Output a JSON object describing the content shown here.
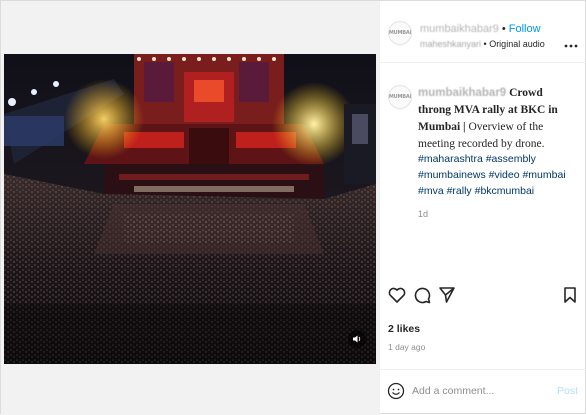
{
  "post": {
    "username": "mumbaikhabar9",
    "follow_label": "Follow",
    "audio_user": "maheshkanyari",
    "audio_label": "Original audio",
    "avatar_text": "MUMBAI",
    "caption_user": "mumbaikhabar9",
    "caption_title": "Crowd throng MVA rally at BKC in Mumbai |",
    "caption_body": "Overview of the meeting recorded by drone.",
    "hashtags": "#maharashtra #assembly #mumbainews #video #mumbai #mva #rally #bkcmumbai",
    "caption_age": "1d",
    "likes": "2 likes",
    "posted_ago": "1 day ago",
    "comment_placeholder": "Add a comment...",
    "post_label": "Post"
  },
  "icons": {
    "more": "more-options-icon",
    "like": "heart-icon",
    "comment": "comment-icon",
    "share": "send-icon",
    "save": "bookmark-icon",
    "emoji": "emoji-icon",
    "mute": "speaker-icon"
  },
  "colors": {
    "follow": "#0095f6",
    "hashtag": "#00376b",
    "post_disabled": "#b2dffc",
    "muted_text": "#8e8e8e"
  }
}
